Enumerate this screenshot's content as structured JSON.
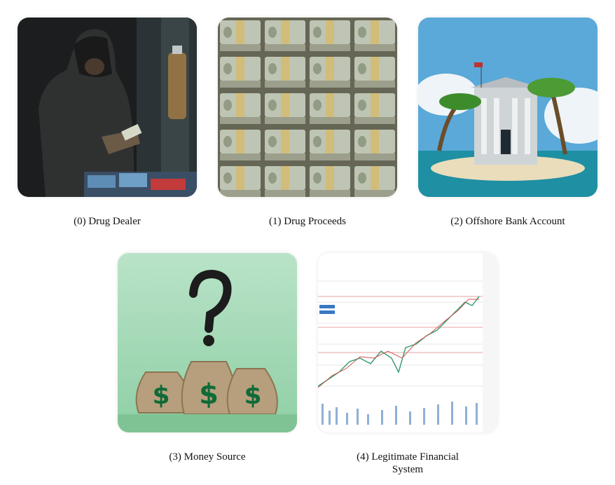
{
  "panels": [
    {
      "caption": "(0) Drug Dealer",
      "icon": "hooded-dealer-image"
    },
    {
      "caption": "(1) Drug Proceeds",
      "icon": "cash-stacks-image"
    },
    {
      "caption": "(2) Offshore Bank Account",
      "icon": "island-bank-image"
    },
    {
      "caption": "(3) Money Source",
      "icon": "money-bags-question-image"
    },
    {
      "caption": "(4) Legitimate Financial System",
      "icon": "stock-chart-image"
    }
  ]
}
